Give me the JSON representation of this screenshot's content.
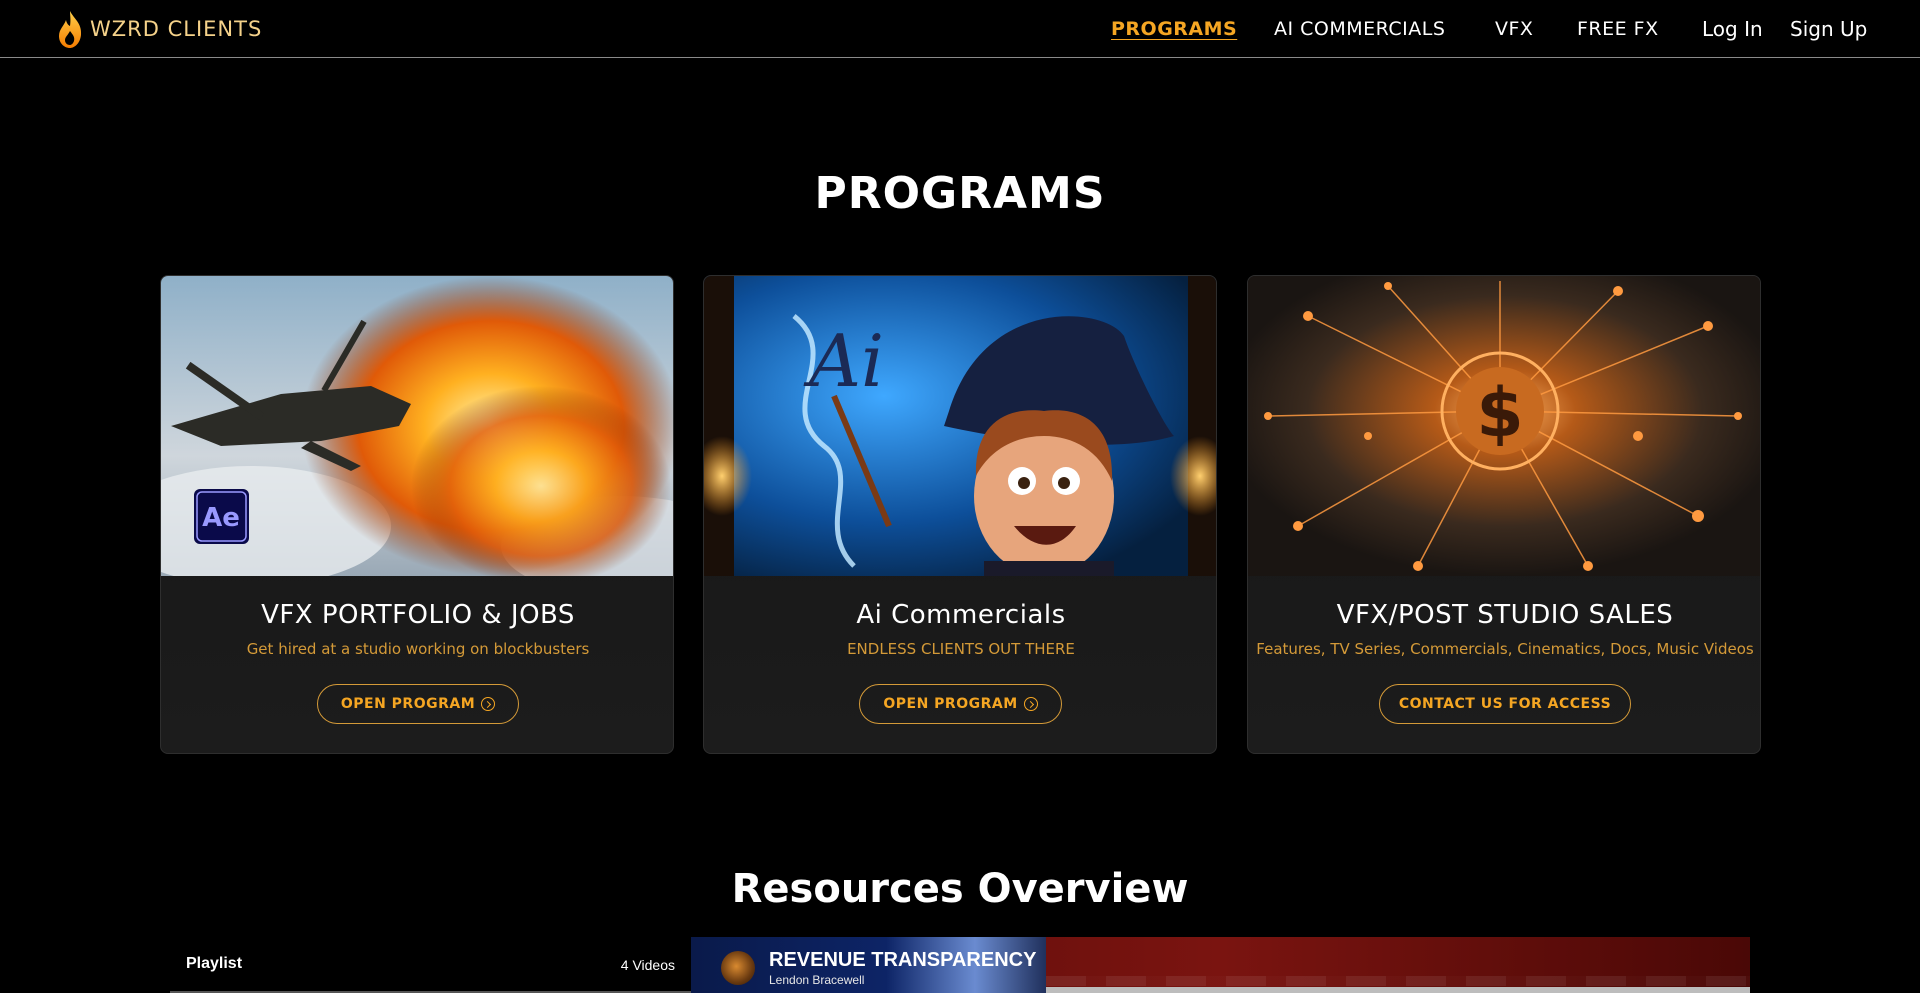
{
  "brand": {
    "name": "WZRD CLIENTS"
  },
  "nav": {
    "items": [
      {
        "label": "PROGRAMS",
        "active": true
      },
      {
        "label": "AI COMMERCIALS",
        "active": false
      },
      {
        "label": "VFX",
        "active": false
      },
      {
        "label": "FREE FX",
        "active": false
      }
    ],
    "login": "Log In",
    "signup": "Sign Up"
  },
  "programs": {
    "title": "PROGRAMS",
    "cards": [
      {
        "title": "VFX PORTFOLIO & JOBS",
        "subtitle": "Get hired at a studio working on blockbusters",
        "button": "OPEN PROGRAM",
        "image_icon": "after-effects-badge",
        "badge": "Ae"
      },
      {
        "title": "Ai Commercials",
        "subtitle": "ENDLESS CLIENTS OUT THERE",
        "button": "OPEN PROGRAM",
        "image_icon": "wizard-illustration",
        "badge": "Ai"
      },
      {
        "title": "VFX/POST STUDIO SALES",
        "subtitle": "Features, TV Series, Commercials, Cinematics, Docs, Music Videos",
        "button": "CONTACT US FOR ACCESS",
        "image_icon": "dollar-network-illustration",
        "badge": "$"
      }
    ]
  },
  "resources": {
    "title": "Resources Overview",
    "playlist": {
      "label": "Playlist",
      "count": "4 Videos"
    },
    "video": {
      "title": "REVENUE TRANSPARENCY",
      "author": "Lendon Bracewell"
    }
  },
  "colors": {
    "accent": "#f5a623",
    "accent_muted": "#d49a38",
    "background": "#000000",
    "card_bg": "#181818"
  }
}
